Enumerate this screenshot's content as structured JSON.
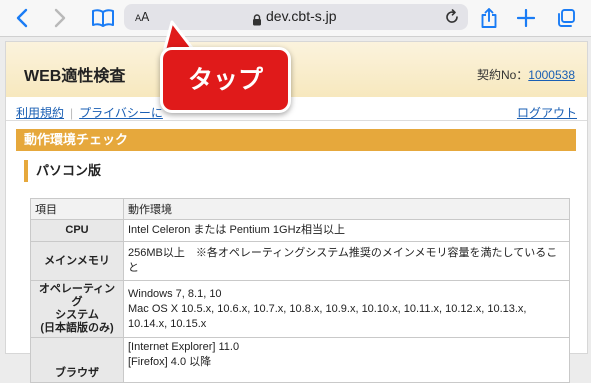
{
  "browser": {
    "text_size_label": "AA",
    "domain": "dev.cbt-s.jp"
  },
  "header": {
    "title": "WEB適性検査",
    "contract_label": "契約No：",
    "contract_no": "1000538"
  },
  "nav": {
    "terms": "利用規約",
    "privacy": "プライバシーに",
    "logout": "ログアウト"
  },
  "section": {
    "title": "動作環境チェック"
  },
  "subsection": {
    "title": "パソコン版"
  },
  "table": {
    "headers": [
      "項目",
      "動作環境"
    ],
    "rows": [
      {
        "item": "CPU",
        "value": "Intel Celeron または Pentium 1GHz相当以上"
      },
      {
        "item": "メインメモリ",
        "value": "256MB以上　※各オペレーティングシステム推奨のメインメモリ容量を満たしていること"
      },
      {
        "item_lines": [
          "オペレーティング",
          "システム",
          "(日本語版のみ)"
        ],
        "value_lines": [
          "Windows 7, 8.1, 10",
          "Mac OS X 10.5.x, 10.6.x, 10.7.x, 10.8.x, 10.9.x, 10.10.x, 10.11.x, 10.12.x, 10.13.x, 10.14.x, 10.15.x"
        ]
      },
      {
        "item": "ブラウザ",
        "value_lines": [
          "[Internet Explorer] 11.0",
          "[Firefox] 4.0 以降"
        ]
      }
    ]
  },
  "callout": {
    "label": "タップ",
    "color": "#e01a1a"
  }
}
